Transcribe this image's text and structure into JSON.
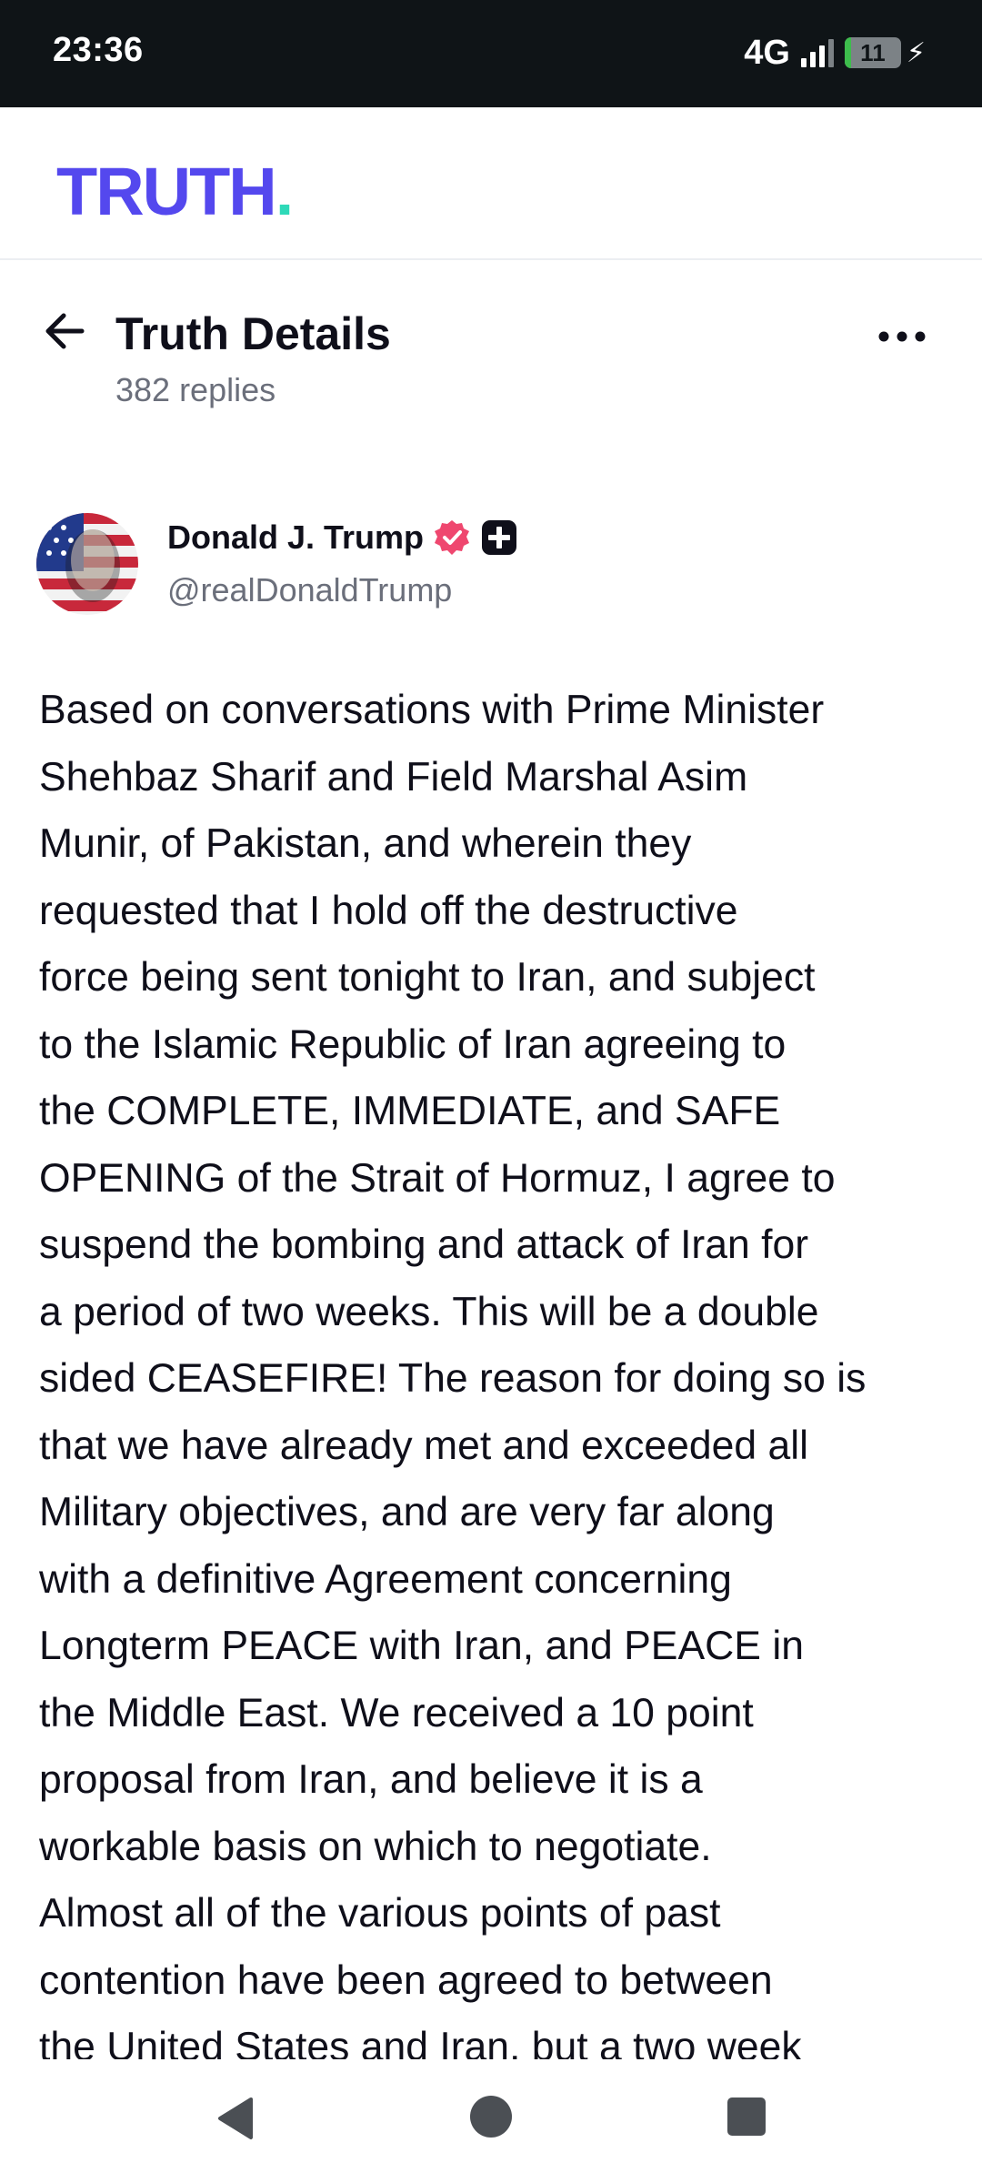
{
  "status_bar": {
    "time": "23:36",
    "network": "4G",
    "battery_level": "11",
    "battery_fraction": 0.11
  },
  "brand": {
    "logo_text": "TRUTH",
    "logo_dot": ".",
    "logo_color": "#5448ee",
    "dot_color": "#2ed9b8"
  },
  "header": {
    "title": "Truth Details",
    "replies": "382 replies",
    "back_icon": "arrow-left-icon",
    "more_icon": "more-horizontal-icon"
  },
  "author": {
    "name": "Donald J. Trump",
    "handle": "@realDonaldTrump",
    "verified_icon": "verified-badge-icon",
    "verified_color": "#ef476f",
    "plus_icon": "plus-badge-icon"
  },
  "post": {
    "lines": [
      "Based on conversations with Prime Minister",
      "Shehbaz Sharif and Field Marshal Asim",
      "Munir, of Pakistan, and wherein they",
      "requested that I hold off the destructive",
      "force being sent tonight to Iran, and subject",
      "to the Islamic Republic of Iran agreeing to",
      "the COMPLETE, IMMEDIATE, and SAFE",
      "OPENING of the Strait of Hormuz, I agree to",
      "suspend the bombing and attack of Iran for",
      "a period of two weeks. This will be a double",
      "sided CEASEFIRE! The reason for doing so is",
      "that we have already met and exceeded all",
      "Military objectives, and are very far along",
      "with a definitive Agreement concerning",
      "Longterm PEACE with Iran, and PEACE in",
      "the Middle East. We received a 10 point",
      "proposal from Iran, and believe it is a",
      "workable basis on which to negotiate.",
      "Almost all of the various points of past",
      "contention have been agreed to between",
      "the United States and Iran, but a two week"
    ]
  },
  "nav": {
    "back": "nav-back-icon",
    "home": "nav-home-icon",
    "recents": "nav-recents-icon"
  }
}
